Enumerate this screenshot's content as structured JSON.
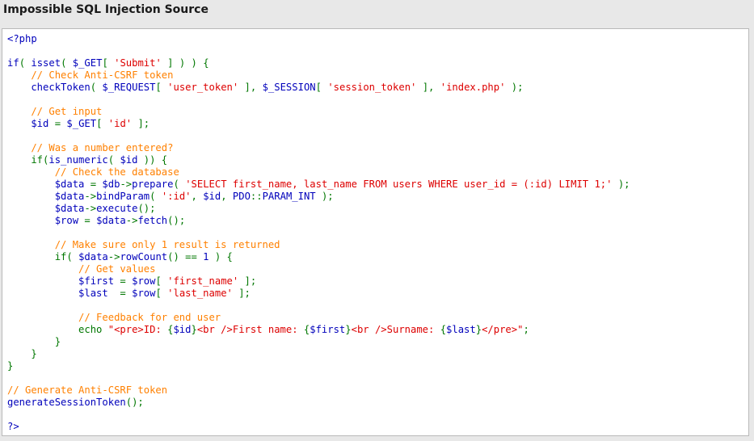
{
  "title": "Impossible SQL Injection Source",
  "colors": {
    "default": "#0000bb",
    "keyword": "#007700",
    "string": "#dd0000",
    "comment": "#ff8000",
    "background": "#e8e8e8",
    "code_background": "#ffffff"
  },
  "code": {
    "lines": [
      [
        [
          "default",
          "<?php"
        ]
      ],
      [],
      [
        [
          "default",
          "if"
        ],
        [
          "keyword",
          "( "
        ],
        [
          "default",
          "isset"
        ],
        [
          "keyword",
          "( "
        ],
        [
          "default",
          "$_GET"
        ],
        [
          "keyword",
          "[ "
        ],
        [
          "string",
          "'Submit'"
        ],
        [
          "keyword",
          " ] ) ) {"
        ]
      ],
      [
        [
          "comment",
          "    // Check Anti-CSRF token"
        ]
      ],
      [
        [
          "default",
          "    checkToken"
        ],
        [
          "keyword",
          "( "
        ],
        [
          "default",
          "$_REQUEST"
        ],
        [
          "keyword",
          "[ "
        ],
        [
          "string",
          "'user_token'"
        ],
        [
          "keyword",
          " ], "
        ],
        [
          "default",
          "$_SESSION"
        ],
        [
          "keyword",
          "[ "
        ],
        [
          "string",
          "'session_token'"
        ],
        [
          "keyword",
          " ], "
        ],
        [
          "string",
          "'index.php'"
        ],
        [
          "keyword",
          " );"
        ]
      ],
      [],
      [
        [
          "comment",
          "    // Get input"
        ]
      ],
      [
        [
          "default",
          "    $id "
        ],
        [
          "keyword",
          "= "
        ],
        [
          "default",
          "$_GET"
        ],
        [
          "keyword",
          "[ "
        ],
        [
          "string",
          "'id'"
        ],
        [
          "keyword",
          " ];"
        ]
      ],
      [],
      [
        [
          "comment",
          "    // Was a number entered?"
        ]
      ],
      [
        [
          "keyword",
          "    if("
        ],
        [
          "default",
          "is_numeric"
        ],
        [
          "keyword",
          "( "
        ],
        [
          "default",
          "$id "
        ],
        [
          "keyword",
          ")) {"
        ]
      ],
      [
        [
          "comment",
          "        // Check the database"
        ]
      ],
      [
        [
          "default",
          "        $data "
        ],
        [
          "keyword",
          "= "
        ],
        [
          "default",
          "$db"
        ],
        [
          "keyword",
          "-&gt;"
        ],
        [
          "default",
          "prepare"
        ],
        [
          "keyword",
          "( "
        ],
        [
          "string",
          "'SELECT first_name, last_name FROM users WHERE user_id = (:id) LIMIT 1;'"
        ],
        [
          "keyword",
          " );"
        ]
      ],
      [
        [
          "default",
          "        $data"
        ],
        [
          "keyword",
          "-&gt;"
        ],
        [
          "default",
          "bindParam"
        ],
        [
          "keyword",
          "( "
        ],
        [
          "string",
          "':id'"
        ],
        [
          "keyword",
          ", "
        ],
        [
          "default",
          "$id"
        ],
        [
          "keyword",
          ", "
        ],
        [
          "default",
          "PDO"
        ],
        [
          "keyword",
          "::"
        ],
        [
          "default",
          "PARAM_INT "
        ],
        [
          "keyword",
          ");"
        ]
      ],
      [
        [
          "default",
          "        $data"
        ],
        [
          "keyword",
          "-&gt;"
        ],
        [
          "default",
          "execute"
        ],
        [
          "keyword",
          "();"
        ]
      ],
      [
        [
          "default",
          "        $row "
        ],
        [
          "keyword",
          "= "
        ],
        [
          "default",
          "$data"
        ],
        [
          "keyword",
          "-&gt;"
        ],
        [
          "default",
          "fetch"
        ],
        [
          "keyword",
          "();"
        ]
      ],
      [],
      [
        [
          "comment",
          "        // Make sure only 1 result is returned"
        ]
      ],
      [
        [
          "keyword",
          "        if( "
        ],
        [
          "default",
          "$data"
        ],
        [
          "keyword",
          "-&gt;"
        ],
        [
          "default",
          "rowCount"
        ],
        [
          "keyword",
          "() == "
        ],
        [
          "default",
          "1 "
        ],
        [
          "keyword",
          ") {"
        ]
      ],
      [
        [
          "comment",
          "            // Get values"
        ]
      ],
      [
        [
          "default",
          "            $first "
        ],
        [
          "keyword",
          "= "
        ],
        [
          "default",
          "$row"
        ],
        [
          "keyword",
          "[ "
        ],
        [
          "string",
          "'first_name'"
        ],
        [
          "keyword",
          " ];"
        ]
      ],
      [
        [
          "default",
          "            $last  "
        ],
        [
          "keyword",
          "= "
        ],
        [
          "default",
          "$row"
        ],
        [
          "keyword",
          "[ "
        ],
        [
          "string",
          "'last_name'"
        ],
        [
          "keyword",
          " ];"
        ]
      ],
      [],
      [
        [
          "comment",
          "            // Feedback for end user"
        ]
      ],
      [
        [
          "keyword",
          "            echo "
        ],
        [
          "string",
          "\"&lt;pre&gt;ID: "
        ],
        [
          "keyword",
          "{"
        ],
        [
          "default",
          "$id"
        ],
        [
          "keyword",
          "}"
        ],
        [
          "string",
          "&lt;br /&gt;First name: "
        ],
        [
          "keyword",
          "{"
        ],
        [
          "default",
          "$first"
        ],
        [
          "keyword",
          "}"
        ],
        [
          "string",
          "&lt;br /&gt;Surname: "
        ],
        [
          "keyword",
          "{"
        ],
        [
          "default",
          "$last"
        ],
        [
          "keyword",
          "}"
        ],
        [
          "string",
          "&lt;/pre&gt;\""
        ],
        [
          "keyword",
          ";"
        ]
      ],
      [
        [
          "keyword",
          "        }"
        ]
      ],
      [
        [
          "keyword",
          "    }"
        ]
      ],
      [
        [
          "keyword",
          "}"
        ]
      ],
      [],
      [
        [
          "comment",
          "// Generate Anti-CSRF token"
        ]
      ],
      [
        [
          "default",
          "generateSessionToken"
        ],
        [
          "keyword",
          "();"
        ]
      ],
      [],
      [
        [
          "default",
          "?>"
        ]
      ]
    ]
  }
}
